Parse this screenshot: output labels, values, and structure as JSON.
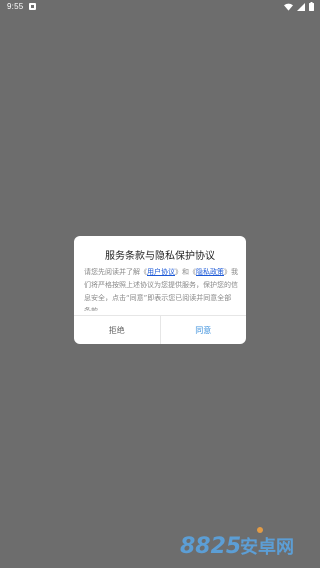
{
  "status_bar": {
    "time": "9:55",
    "icons": [
      "app-notification-icon",
      "wifi-icon",
      "signal-icon",
      "battery-icon"
    ]
  },
  "dialog": {
    "title": "服务条款与隐私保护协议",
    "body": {
      "part1": "请您先阅读并了解《",
      "user_agreement": "用户协议",
      "part2": "》和《",
      "privacy_policy": "隐私政策",
      "part3": "》我们将严格按照上述协议为您提供服务，保护您的信息安全，点击“同意”即表示您已阅读并同意全部条款。"
    },
    "reject_label": "拒绝",
    "accept_label": "同意"
  },
  "colors": {
    "overlay": "#6d6d6d",
    "link": "#1a57d6",
    "accept": "#3a8fdc"
  },
  "watermark": {
    "text": "8825安卓网"
  }
}
